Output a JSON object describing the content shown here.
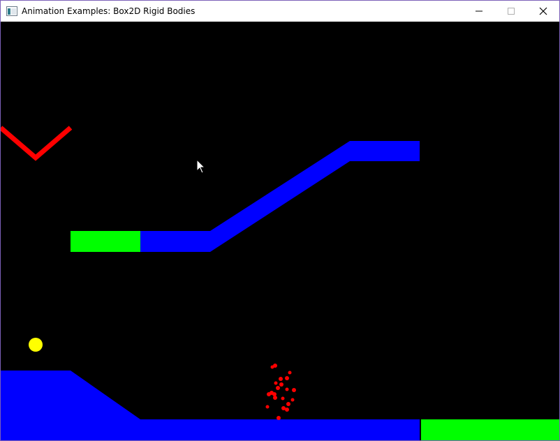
{
  "window": {
    "title": "Animation Examples: Box2D Rigid Bodies",
    "app_icon": "window-app-icon",
    "controls": [
      "minimize-icon",
      "maximize-icon",
      "close-icon"
    ]
  },
  "scene": {
    "background": "#000000",
    "colors": {
      "blue": "#0000ff",
      "green": "#00ff00",
      "red": "#ff0000",
      "yellow": "#ffff00"
    },
    "bodies": [
      "red-v-bracket",
      "upper-ramp",
      "green-platform-upper",
      "yellow-ball",
      "lower-ground-ramp",
      "green-platform-lower",
      "red-particle-cluster"
    ]
  },
  "cursor": "arrow-cursor-icon"
}
